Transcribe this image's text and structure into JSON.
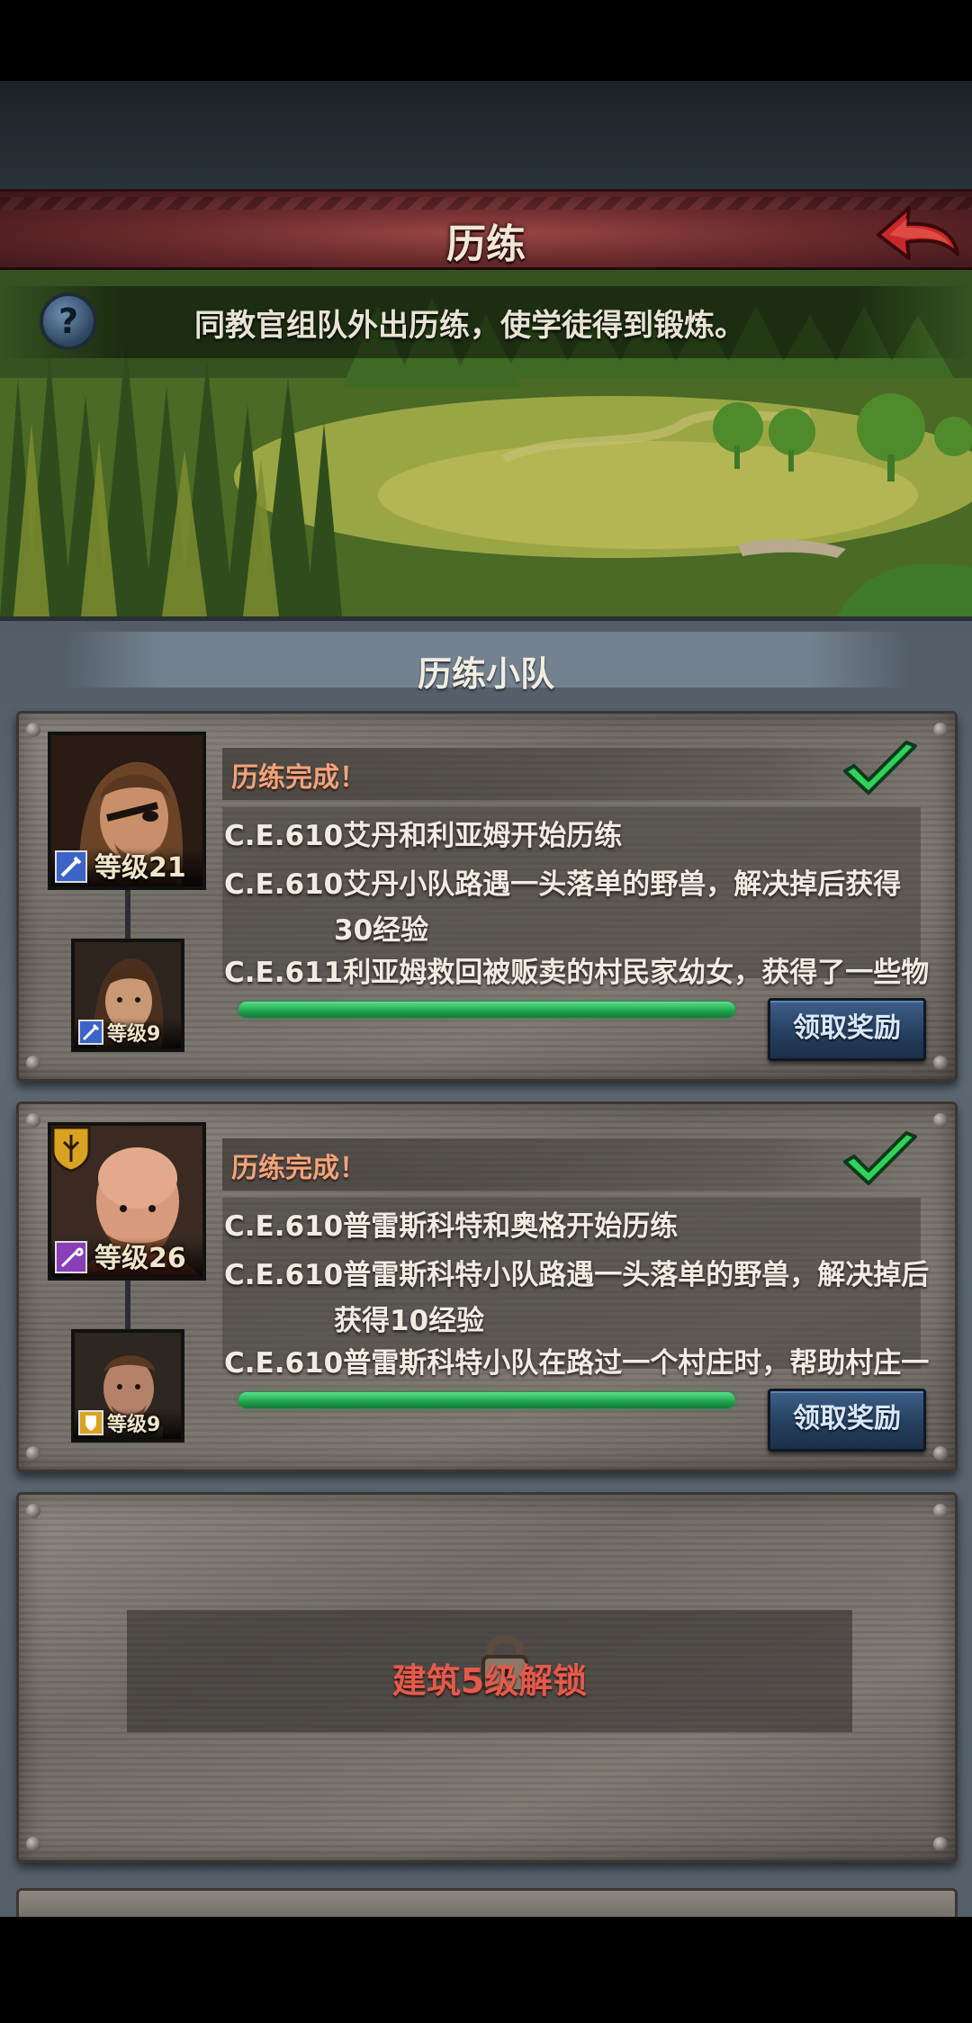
{
  "header": {
    "title": "历练"
  },
  "intro": {
    "text": "同教官组队外出历练，使学徒得到锻炼。"
  },
  "section": {
    "title": "历练小队"
  },
  "squads": [
    {
      "status": "历练完成！",
      "leader_level": "等级21",
      "member_level": "等级9",
      "logs": [
        {
          "date": "C.E.610",
          "text": "艾丹和利亚姆开始历练",
          "cont": ""
        },
        {
          "date": "C.E.610",
          "text": "艾丹小队路遇一头落单的野兽，解决掉后获得",
          "cont": "30经验"
        },
        {
          "date": "C.E.611",
          "text": "利亚姆救回被贩卖的村民家幼女，获得了一些物",
          "cont": ""
        }
      ],
      "progress": 1.0,
      "claim_label": "领取奖励",
      "leader_class_color": "#3b63c8",
      "member_class_color": "#3b63c8"
    },
    {
      "status": "历练完成！",
      "leader_level": "等级26",
      "member_level": "等级9",
      "logs": [
        {
          "date": "C.E.610",
          "text": "普雷斯科特和奥格开始历练",
          "cont": ""
        },
        {
          "date": "C.E.610",
          "text": "普雷斯科特小队路遇一头落单的野兽，解决掉后",
          "cont": "获得10经验"
        },
        {
          "date": "C.E.610",
          "text": "普雷斯科特小队在路过一个村庄时，帮助村庄一",
          "cont": ""
        }
      ],
      "progress": 1.0,
      "claim_label": "领取奖励",
      "leader_class_color": "#8a3fb8",
      "member_class_color": "#d9a321"
    }
  ],
  "locked_slot": {
    "text": "建筑5级解锁"
  },
  "colors": {
    "status_text": "#f1a37b",
    "unlock_text": "#e35b4a",
    "progress": "#2bbf5c",
    "check": "#2fd35a"
  }
}
